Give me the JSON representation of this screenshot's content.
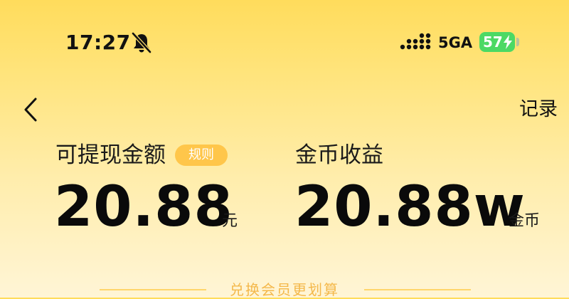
{
  "status_bar": {
    "time": "17:27",
    "network": "5GA",
    "battery_level": "57",
    "icons": {
      "mute": "bell-slash-icon",
      "signal": "signal-dots-icon",
      "charging": "bolt-icon"
    },
    "battery_color": "#4cd964"
  },
  "nav": {
    "back_icon": "chevron-left-icon",
    "records_label": "记录"
  },
  "withdraw": {
    "label": "可提现金额",
    "rules_label": "规则",
    "amount": "20.88",
    "unit": "元"
  },
  "coins": {
    "label": "金币收益",
    "amount": "20.88w",
    "unit": "金币"
  },
  "exchange": {
    "caption": "兑换会员更划算"
  },
  "colors": {
    "background_top": "#ffdc5c",
    "background_bottom": "#fff5d6",
    "badge": "#ffc64a",
    "caption": "#f4b84a"
  }
}
